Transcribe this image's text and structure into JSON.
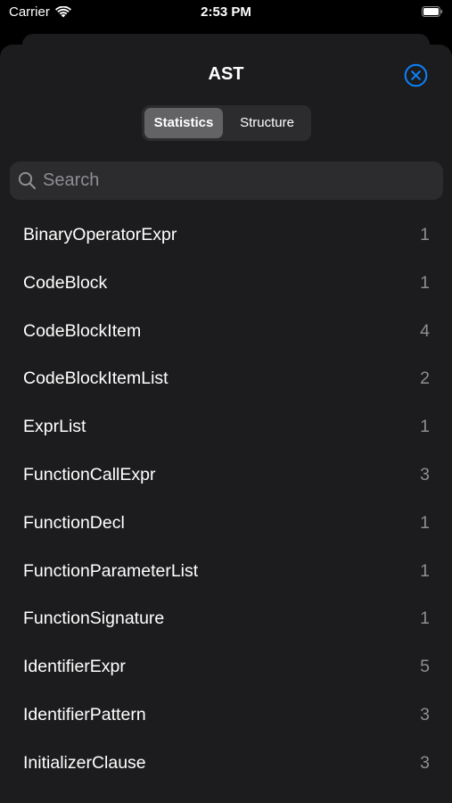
{
  "status_bar": {
    "carrier": "Carrier",
    "time": "2:53 PM"
  },
  "sheet": {
    "title": "AST",
    "close_icon": "xmark-circle-icon",
    "accent_color": "#0a84ff"
  },
  "segmented": {
    "options": [
      "Statistics",
      "Structure"
    ],
    "selected": "Statistics"
  },
  "search": {
    "placeholder": "Search",
    "value": ""
  },
  "items": [
    {
      "label": "BinaryOperatorExpr",
      "count": "1"
    },
    {
      "label": "CodeBlock",
      "count": "1"
    },
    {
      "label": "CodeBlockItem",
      "count": "4"
    },
    {
      "label": "CodeBlockItemList",
      "count": "2"
    },
    {
      "label": "ExprList",
      "count": "1"
    },
    {
      "label": "FunctionCallExpr",
      "count": "3"
    },
    {
      "label": "FunctionDecl",
      "count": "1"
    },
    {
      "label": "FunctionParameterList",
      "count": "1"
    },
    {
      "label": "FunctionSignature",
      "count": "1"
    },
    {
      "label": "IdentifierExpr",
      "count": "5"
    },
    {
      "label": "IdentifierPattern",
      "count": "3"
    },
    {
      "label": "InitializerClause",
      "count": "3"
    }
  ]
}
